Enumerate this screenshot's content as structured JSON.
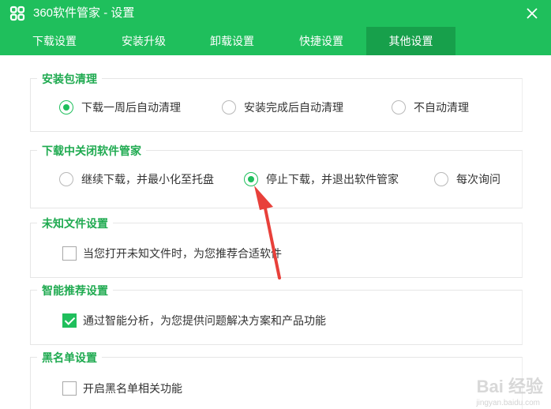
{
  "window": {
    "title": "360软件管家 - 设置",
    "logo_icon": "app-logo-icon",
    "close_icon": "close-icon",
    "accent": "#1fbf5c",
    "tab_active_bg": "#17a04b",
    "title_color": "#1faa50"
  },
  "tabs": [
    {
      "label": "下载设置",
      "active": false
    },
    {
      "label": "安装升级",
      "active": false
    },
    {
      "label": "卸载设置",
      "active": false
    },
    {
      "label": "快捷设置",
      "active": false
    },
    {
      "label": "其他设置",
      "active": true
    }
  ],
  "groups": {
    "package_cleanup": {
      "title": "安装包清理",
      "options": [
        {
          "label": "下载一周后自动清理",
          "checked": true
        },
        {
          "label": "安装完成后自动清理",
          "checked": false
        },
        {
          "label": "不自动清理",
          "checked": false
        }
      ]
    },
    "close_during_download": {
      "title": "下载中关闭软件管家",
      "options": [
        {
          "label": "继续下载，并最小化至托盘",
          "checked": false
        },
        {
          "label": "停止下载，并退出软件管家",
          "checked": true
        },
        {
          "label": "每次询问",
          "checked": false
        }
      ]
    },
    "unknown_files": {
      "title": "未知文件设置",
      "option": {
        "label": "当您打开未知文件时，为您推荐合适软件",
        "checked": false
      }
    },
    "smart_recommend": {
      "title": "智能推荐设置",
      "option": {
        "label": "通过智能分析，为您提供问题解决方案和产品功能",
        "checked": true
      }
    },
    "blacklist": {
      "title": "黑名单设置",
      "option": {
        "label": "开启黑名单相关功能",
        "checked": false
      }
    }
  },
  "annotation": {
    "arrow_color": "#e8403a"
  },
  "watermark": {
    "text": "Bai 经验",
    "sub": "jingyan.baidu.com"
  }
}
